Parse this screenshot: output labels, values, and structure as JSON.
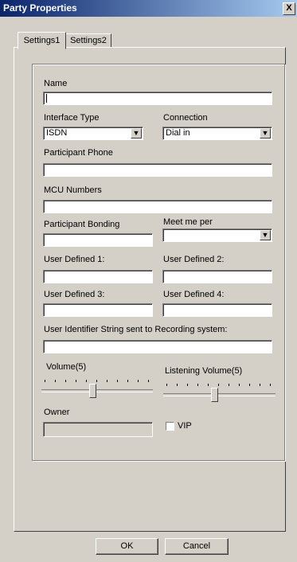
{
  "window": {
    "title": "Party Properties",
    "close_glyph": "X"
  },
  "tabs": [
    {
      "label": "Settings1",
      "active": true
    },
    {
      "label": "Settings2",
      "active": false
    }
  ],
  "form": {
    "name_label": "Name",
    "name_value": "",
    "interface_type_label": "Interface Type",
    "interface_type_value": "ISDN",
    "connection_label": "Connection",
    "connection_value": "Dial in",
    "participant_phone_label": "Participant Phone",
    "mcu_numbers_label": "MCU Numbers",
    "participant_bonding_label": "Participant Bonding",
    "meet_me_per_label": "Meet me per",
    "meet_me_per_value": "",
    "user_defined_1_label": "User Defined 1:",
    "user_defined_2_label": "User Defined 2:",
    "user_defined_3_label": "User Defined 3:",
    "user_defined_4_label": "User Defined 4:",
    "uid_label": "User Identifier String sent to Recording system:",
    "volume_label": "Volume(5)",
    "volume_level": 5,
    "listening_volume_label": "Listening Volume(5)",
    "listening_volume_level": 5,
    "owner_label": "Owner",
    "vip_label": "VIP",
    "vip_checked": false
  },
  "buttons": {
    "ok": "OK",
    "cancel": "Cancel"
  },
  "icons": {
    "dropdown": "chevron-down-icon",
    "close": "close-icon"
  }
}
